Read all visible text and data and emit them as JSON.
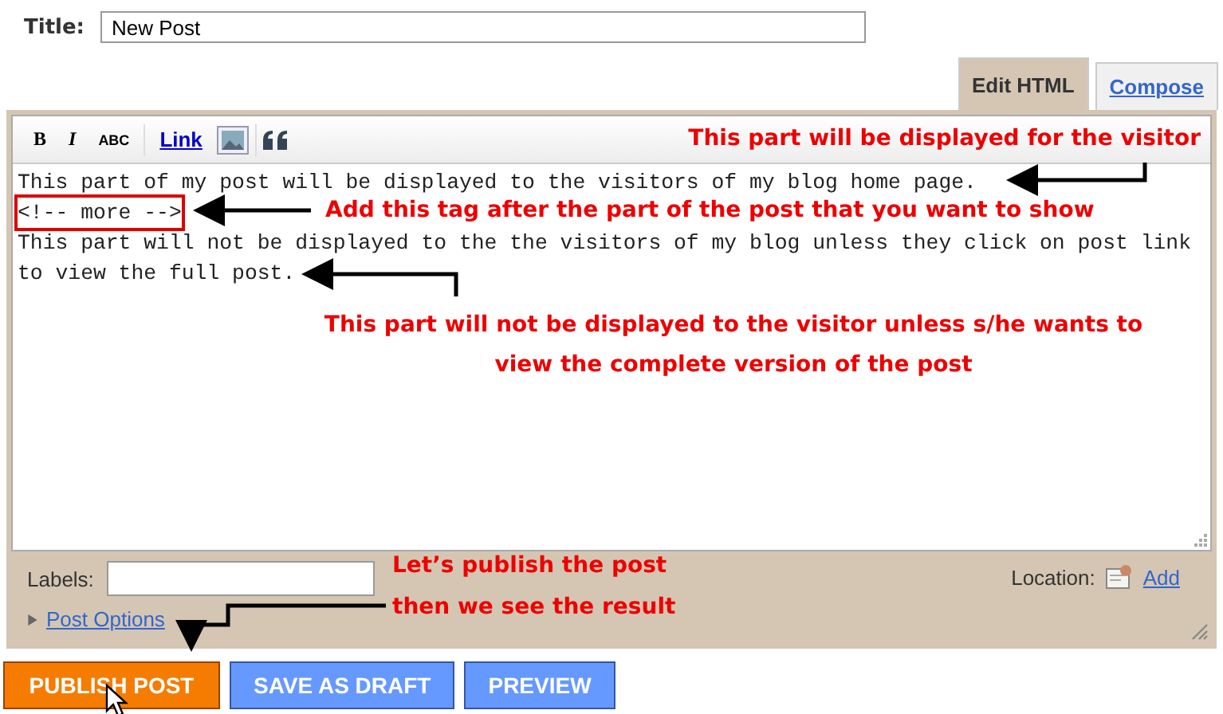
{
  "title_field": {
    "label": "Title:",
    "value": "New Post"
  },
  "tabs": [
    {
      "label": "Edit HTML",
      "selected": true
    },
    {
      "label": "Compose",
      "selected": false
    }
  ],
  "toolbar": [
    {
      "kind": "bold",
      "label": "B"
    },
    {
      "kind": "italic",
      "label": "I"
    },
    {
      "kind": "spell",
      "label": "ABC"
    },
    {
      "kind": "link",
      "label": "Link"
    },
    {
      "kind": "image"
    },
    {
      "kind": "quote"
    }
  ],
  "editor_lines": [
    {
      "text": "This part of my post will be displayed to the visitors of my blog home page.",
      "highlighted": false
    },
    {
      "text": "<!-- more -->",
      "highlighted": true
    },
    {
      "text": "This part will not be displayed to the the visitors of my blog unless they click on post link",
      "highlighted": false
    },
    {
      "text": "to view the full post.",
      "highlighted": false
    }
  ],
  "annotations": [
    "This part will be displayed for the visitor",
    "Add this tag after the part of the post that you want to show",
    "This part will not be displayed to the visitor unless s/he wants to view the complete version of the post",
    "Let’s publish the post then we see the result"
  ],
  "labels_field": {
    "label": "Labels:"
  },
  "location": {
    "label": "Location:",
    "link": "Add"
  },
  "post_options": {
    "label": "Post Options",
    "expanded": false
  },
  "buttons": [
    {
      "label": "PUBLISH POST",
      "kind": "primary"
    },
    {
      "label": "SAVE AS DRAFT",
      "kind": "secondary"
    },
    {
      "label": "PREVIEW",
      "kind": "secondary"
    }
  ]
}
